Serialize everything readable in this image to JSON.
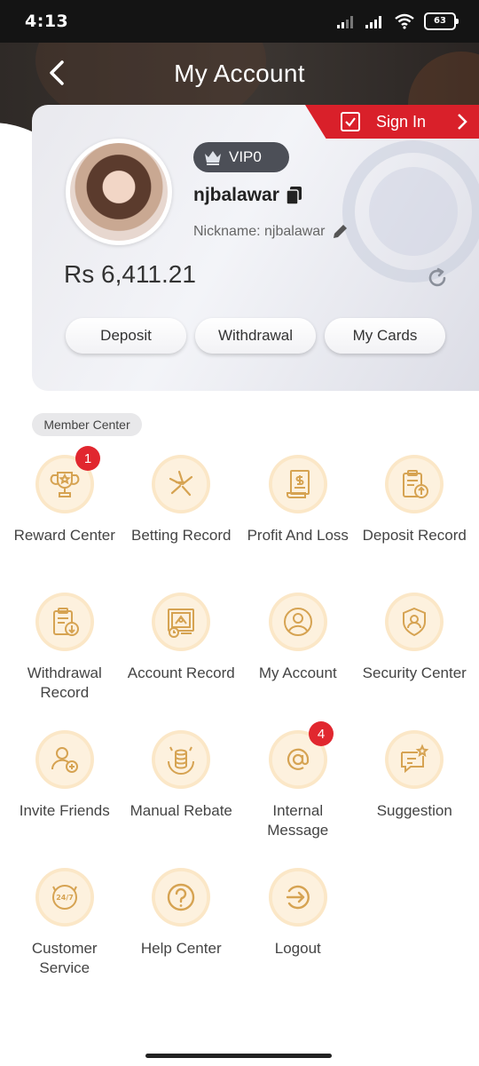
{
  "status": {
    "time": "4:13",
    "battery": "63"
  },
  "nav": {
    "title": "My Account"
  },
  "card": {
    "sign_in_label": "Sign In",
    "vip_label": "VIP0",
    "username": "njbalawar",
    "nickname": "Nickname: njbalawar",
    "balance": "Rs 6,411.21",
    "actions": [
      "Deposit",
      "Withdrawal",
      "My Cards"
    ]
  },
  "member_center": {
    "label": "Member Center",
    "items": [
      {
        "label": "Reward Center",
        "icon": "trophy-icon",
        "badge": "1"
      },
      {
        "label": "Betting Record",
        "icon": "betting-icon"
      },
      {
        "label": "Profit And Loss",
        "icon": "profit-doc-icon"
      },
      {
        "label": "Deposit Record",
        "icon": "deposit-clipboard-icon"
      },
      {
        "label": "Withdrawal Record",
        "icon": "withdrawal-clipboard-icon"
      },
      {
        "label": "Account Record",
        "icon": "account-record-icon"
      },
      {
        "label": "My Account",
        "icon": "user-icon"
      },
      {
        "label": "Security Center",
        "icon": "shield-user-icon"
      },
      {
        "label": "Invite Friends",
        "icon": "invite-user-icon"
      },
      {
        "label": "Manual Rebate",
        "icon": "coins-icon"
      },
      {
        "label": "Internal Message",
        "icon": "at-sign-icon",
        "badge": "4"
      },
      {
        "label": "Suggestion",
        "icon": "chat-star-icon"
      },
      {
        "label": "Customer Service",
        "icon": "support-24-7-icon"
      },
      {
        "label": "Help Center",
        "icon": "question-icon"
      },
      {
        "label": "Logout",
        "icon": "logout-icon"
      }
    ]
  },
  "colors": {
    "accent": "#d9202a",
    "icon_stroke": "#d6a352",
    "icon_bg": "#fdf1de"
  }
}
